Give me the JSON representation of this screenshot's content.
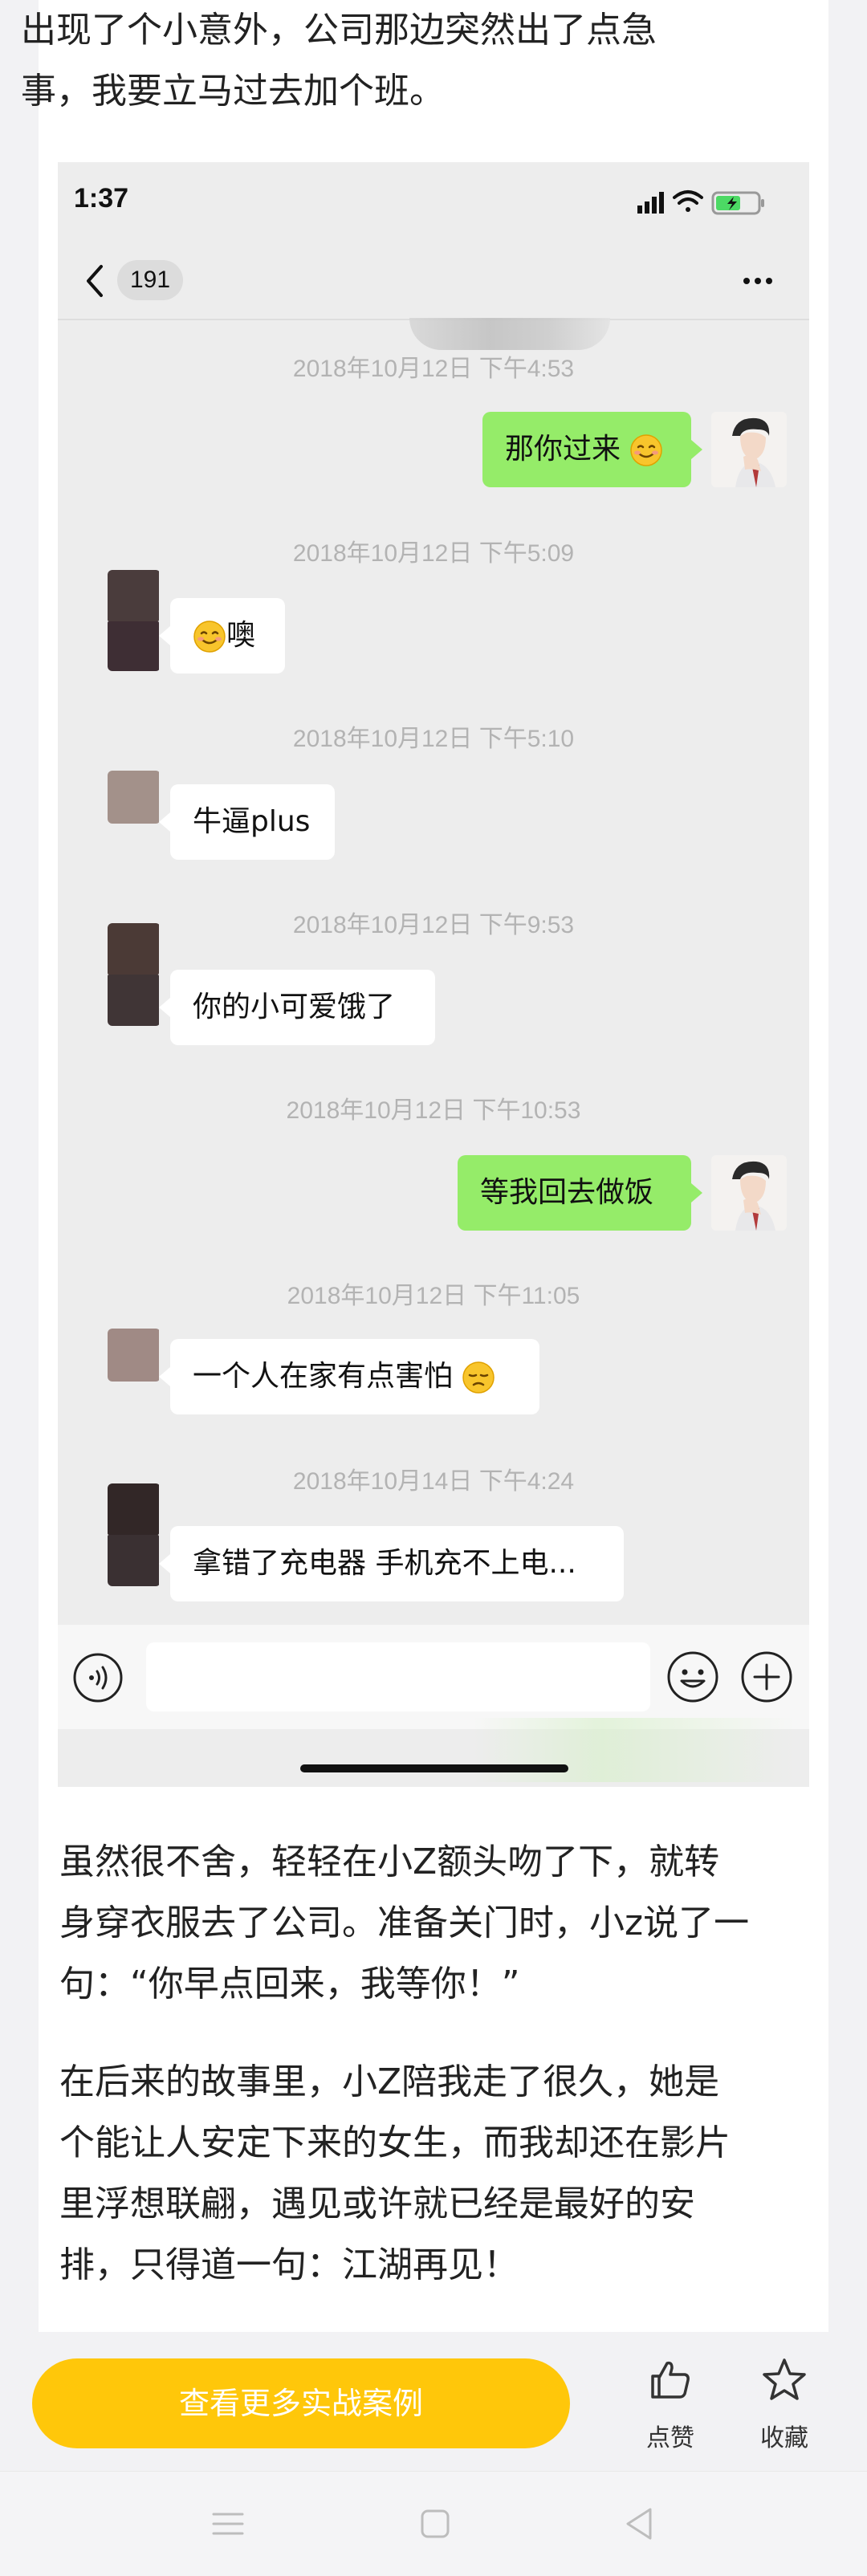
{
  "article": {
    "para_top": [
      "出现了个小意外，公司那边突然出了点急",
      "事，我要立马过去加个班。"
    ],
    "para_mid": [
      "虽然很不舍，轻轻在小Z额头吻了下，就转",
      "身穿衣服去了公司。准备关门时，小z说了一",
      "句：“你早点回来，我等你！”"
    ],
    "para_end": [
      "在后来的故事里，小Z陪我走了很久，她是",
      "个能让人安定下来的女生，而我却还在影片",
      "里浮想联翩，遇见或许就已经是最好的安",
      "排，只得道一句：江湖再见！"
    ]
  },
  "screenshot": {
    "status_time": "1:37",
    "nav_count": "191",
    "messages": [
      {
        "time": "2018年10月12日 下午4:53",
        "side": "right",
        "text": "那你过来"
      },
      {
        "time": "2018年10月12日 下午5:09",
        "side": "left",
        "text": "噢"
      },
      {
        "time": "2018年10月12日 下午5:10",
        "side": "left",
        "text": "牛逼plus"
      },
      {
        "time": "2018年10月12日 下午9:53",
        "side": "left",
        "text": "你的小可爱饿了"
      },
      {
        "time": "2018年10月12日 下午10:53",
        "side": "right",
        "text": "等我回去做饭"
      },
      {
        "time": "2018年10月12日 下午11:05",
        "side": "left",
        "text": "一个人在家有点害怕"
      },
      {
        "time": "2018年10月14日 下午4:24",
        "side": "left",
        "text": "拿错了充电器 手机充不上电..."
      }
    ]
  },
  "bottom_bar": {
    "cta_label": "查看更多实战案例",
    "like_label": "点赞",
    "fav_label": "收藏"
  },
  "colors": {
    "cta": "#ffc70a",
    "bubble_self": "#95ec69",
    "chat_bg": "#ededed"
  },
  "icons": [
    "signal-icon",
    "wifi-icon",
    "battery-icon",
    "back-icon",
    "more-icon",
    "voice-icon",
    "emoji-icon",
    "plus-icon",
    "thumbs-up-icon",
    "star-icon",
    "menu-icon",
    "home-icon",
    "back-triangle-icon"
  ]
}
